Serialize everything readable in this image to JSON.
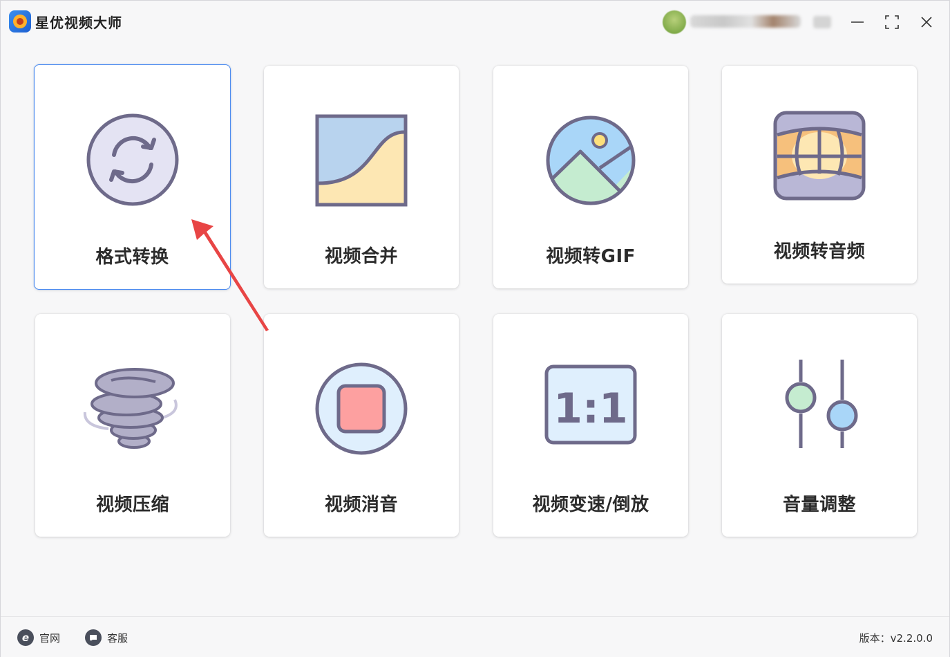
{
  "app": {
    "title": "星优视频大师"
  },
  "window_controls": {
    "minimize": "minimize-icon",
    "maximize": "maximize-icon",
    "close": "close-icon"
  },
  "features": [
    {
      "label": "格式转换",
      "icon": "convert-icon",
      "selected": true
    },
    {
      "label": "视频合并",
      "icon": "merge-icon",
      "selected": false
    },
    {
      "label": "视频转GIF",
      "icon": "image-gif-icon",
      "selected": false
    },
    {
      "label": "视频转音频",
      "icon": "audio-icon",
      "selected": false
    },
    {
      "label": "视频压缩",
      "icon": "compress-icon",
      "selected": false
    },
    {
      "label": "视频消音",
      "icon": "mute-icon",
      "selected": false
    },
    {
      "label": "视频变速/倒放",
      "icon": "speed-icon",
      "selected": false
    },
    {
      "label": "音量调整",
      "icon": "volume-icon",
      "selected": false
    }
  ],
  "icon_text": {
    "ratio": "1:1"
  },
  "colors": {
    "accent": "#4d8cf0",
    "arrow": "#e84545",
    "icon_stroke": "#6e6a8a"
  },
  "footer": {
    "website_label": "官网",
    "website_icon": "e",
    "support_label": "客服",
    "version": "版本：v2.2.0.0"
  }
}
